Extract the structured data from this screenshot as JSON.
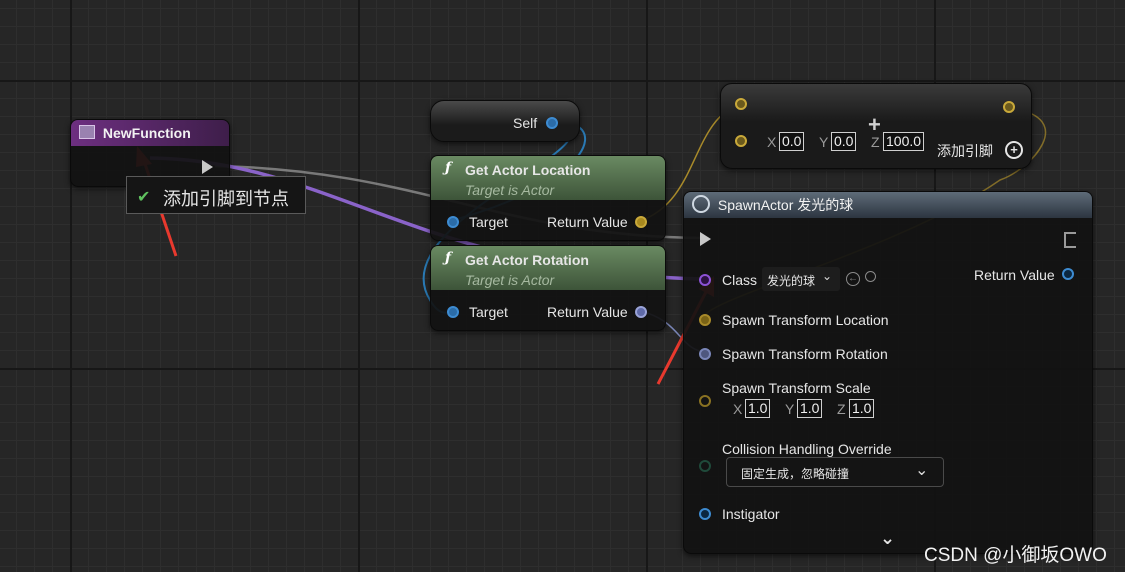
{
  "new_function": {
    "title": "NewFunction"
  },
  "tooltip": {
    "text": "添加引脚到节点"
  },
  "self_node": {
    "label": "Self"
  },
  "get_location": {
    "title": "Get Actor Location",
    "subtitle": "Target is Actor",
    "target_label": "Target",
    "return_label": "Return Value"
  },
  "get_rotation": {
    "title": "Get Actor Rotation",
    "subtitle": "Target is Actor",
    "target_label": "Target",
    "return_label": "Return Value"
  },
  "make_vector": {
    "x_label": "X",
    "x": "0.0",
    "y_label": "Y",
    "y": "0.0",
    "z_label": "Z",
    "z": "100.0",
    "add_pin_label": "添加引脚"
  },
  "spawn": {
    "title": "SpawnActor 发光的球",
    "class_label": "Class",
    "class_value": "发光的球",
    "return_label": "Return Value",
    "location_label": "Spawn Transform Location",
    "rotation_label": "Spawn Transform Rotation",
    "scale_label": "Spawn Transform Scale",
    "scale_x_label": "X",
    "scale_x": "1.0",
    "scale_y_label": "Y",
    "scale_y": "1.0",
    "scale_z_label": "Z",
    "scale_z": "1.0",
    "collision_label": "Collision Handling Override",
    "collision_value": "固定生成，忽略碰撞",
    "instigator_label": "Instigator"
  },
  "watermark": "CSDN @小御坂OWO",
  "colors": {
    "function_header": "#5a2a68",
    "pure_header": "#4f6a4a",
    "spawn_header": "#3c4652",
    "object_pin": "#3d8bd1",
    "vector_pin": "#c9a93a",
    "rotator_pin": "#9aa3d8",
    "class_pin": "#7a2cc7",
    "arrow": "#e8392e"
  },
  "icons": {
    "function": "f-icon",
    "spawn": "spawn-actor-icon",
    "add_pin": "plus-circle-icon",
    "tooltip_check": "check-icon"
  }
}
